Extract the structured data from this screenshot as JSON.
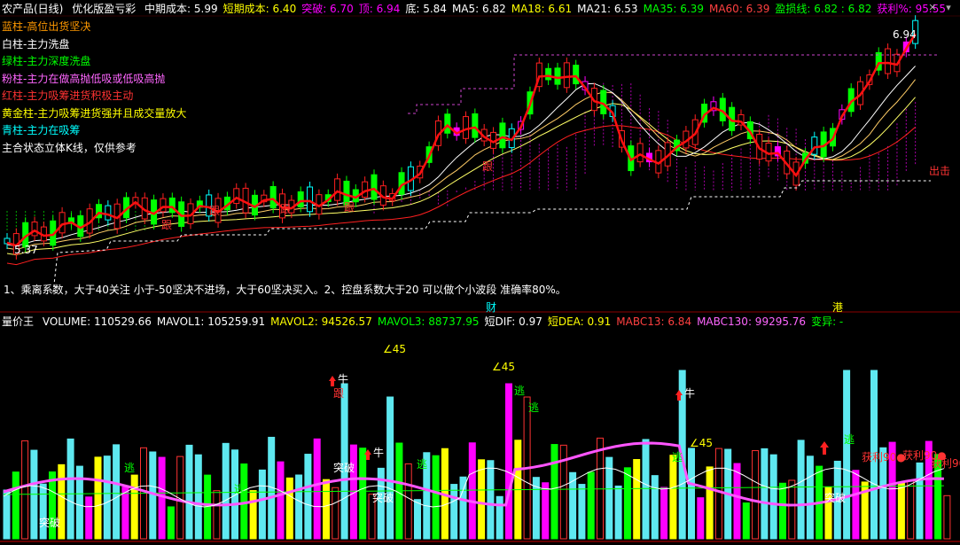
{
  "header": {
    "product": "农产品(日线)",
    "indicator": "优化版盈亏彩",
    "items": [
      {
        "label": "中期成本: 5.99",
        "color": "#ffffff"
      },
      {
        "label": "短期成本: 6.40",
        "color": "#ffff00"
      },
      {
        "label": "突破: 6.70",
        "color": "#ff00ff"
      },
      {
        "label": "顶: 6.94",
        "color": "#ff00ff"
      },
      {
        "label": "底: 5.84",
        "color": "#ffffff"
      },
      {
        "label": "MA5: 6.82",
        "color": "#ffffff"
      },
      {
        "label": "MA18: 6.61",
        "color": "#ffff00"
      },
      {
        "label": "MA21: 6.53",
        "color": "#ffffff"
      },
      {
        "label": "MA35: 6.39",
        "color": "#00ff00"
      },
      {
        "label": "MA60: 6.39",
        "color": "#ff4040"
      },
      {
        "label": "盈损线: 6.82 : 6.82",
        "color": "#00ff00"
      },
      {
        "label": "获利%: 95.55",
        "color": "#ff00ff"
      }
    ]
  },
  "legend": [
    {
      "text": "蓝柱-高位出货坚决",
      "color": "#ff9900"
    },
    {
      "text": "白柱-主力洗盘",
      "color": "#ffffff"
    },
    {
      "text": "绿柱-主力深度洗盘",
      "color": "#00ff00"
    },
    {
      "text": "粉柱-主力在做高抛低吸或低吸高抛",
      "color": "#ff66ff"
    },
    {
      "text": "红柱-主力吸筹进货积极主动",
      "color": "#ff3333"
    },
    {
      "text": "黄金柱-主力吸筹进货强并且成交量放大",
      "color": "#ffff00"
    },
    {
      "text": "青柱-主力在吸筹",
      "color": "#00ffff"
    },
    {
      "text": "主合状态立体K线，仅供参考",
      "color": "#ffffff"
    }
  ],
  "price_labels": {
    "high": "6.94",
    "low": "5.37"
  },
  "annotations": {
    "exit": "出击",
    "follow": "跟",
    "cai": "财",
    "gang": "港"
  },
  "note": "1、乘离系数，大于40关注 小于-50坚决不进场，大于60坚决买入。2、控盘系数大于20 可以做个小波段 准确率80%。",
  "volume_header": {
    "title": "量价王",
    "items": [
      {
        "label": "VOLUME: 110529.66",
        "color": "#ffffff"
      },
      {
        "label": "MAVOL1: 105259.91",
        "color": "#ffffff"
      },
      {
        "label": "MAVOL2: 94526.57",
        "color": "#ffff00"
      },
      {
        "label": "MAVOL3: 88737.95",
        "color": "#00ff00"
      },
      {
        "label": "短DIF: 0.97",
        "color": "#ffffff"
      },
      {
        "label": "短DEA: 0.91",
        "color": "#ffff00"
      },
      {
        "label": "MABC13: 6.84",
        "color": "#ff4040"
      },
      {
        "label": "MABC130: 99295.76",
        "color": "#ff66ff"
      },
      {
        "label": "变异: -",
        "color": "#00ff00"
      }
    ]
  },
  "volume_annotations": {
    "angle": "∠45",
    "escape": "逃",
    "breakout": "突破",
    "bull": "牛",
    "follow": "跟",
    "profit90": "获利90●"
  }
}
